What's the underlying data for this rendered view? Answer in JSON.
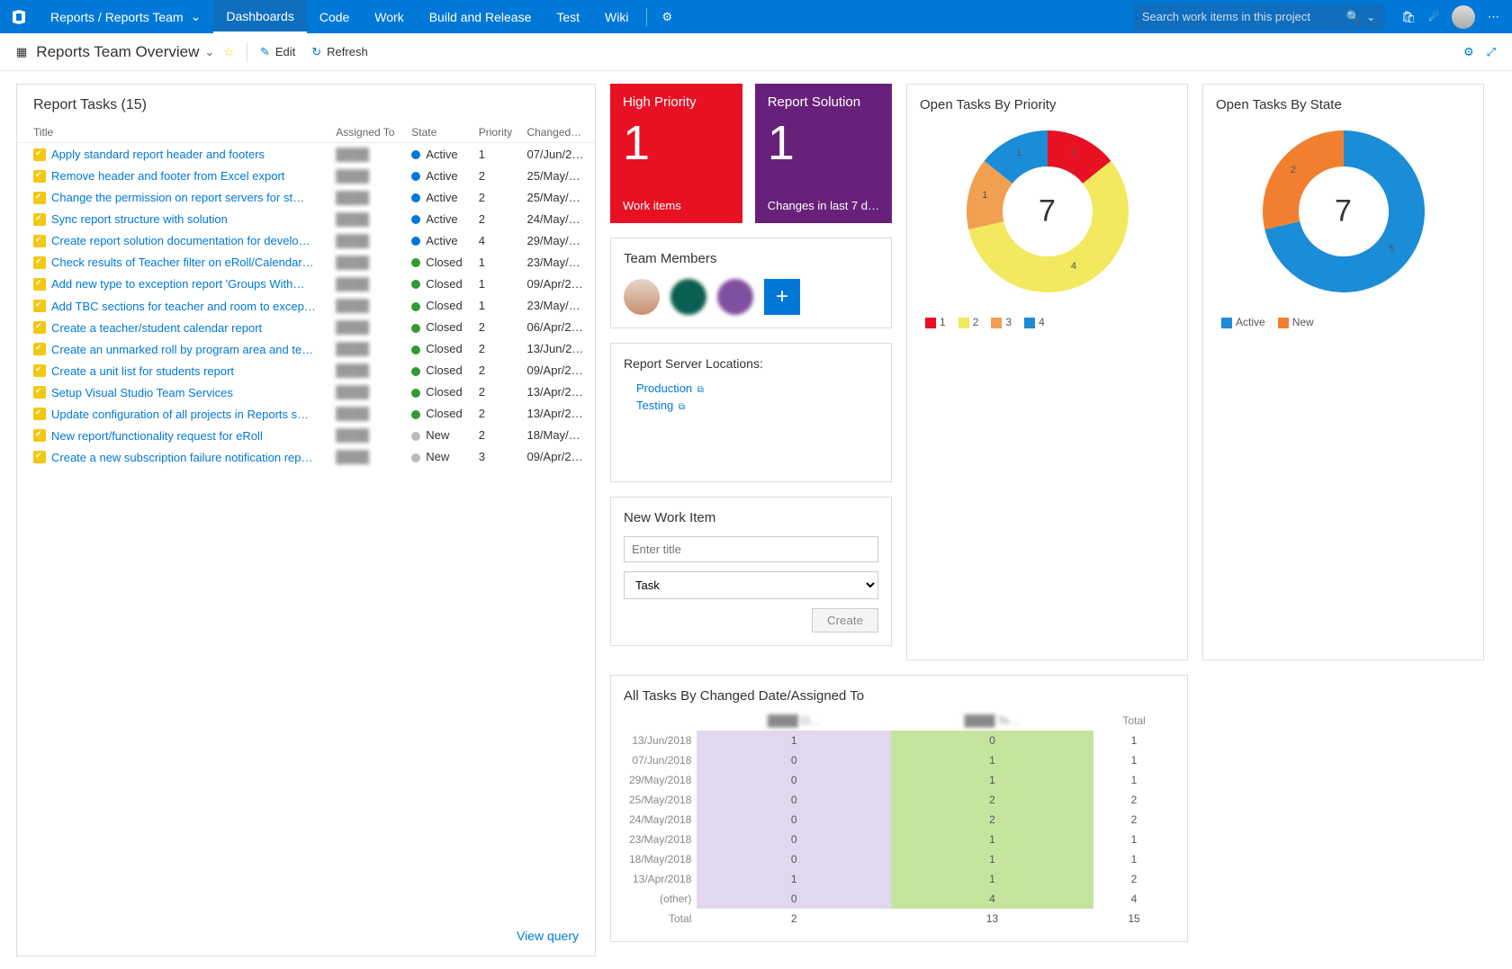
{
  "topbar": {
    "project": "Reports / Reports Team",
    "nav": [
      "Dashboards",
      "Code",
      "Work",
      "Build and Release",
      "Test",
      "Wiki"
    ],
    "active_nav": 0,
    "search_placeholder": "Search work items in this project"
  },
  "toolbar": {
    "title": "Reports Team Overview",
    "edit_label": "Edit",
    "refresh_label": "Refresh"
  },
  "tasks": {
    "title": "Report Tasks (15)",
    "columns": [
      "Title",
      "Assigned To",
      "State",
      "Priority",
      "Changed…"
    ],
    "view_query_label": "View query",
    "rows": [
      {
        "title": "Apply standard report header and footers",
        "assigned": "████",
        "state": "Active",
        "priority": "1",
        "changed": "07/Jun/2…"
      },
      {
        "title": "Remove header and footer from Excel export",
        "assigned": "████",
        "state": "Active",
        "priority": "2",
        "changed": "25/May/…"
      },
      {
        "title": "Change the permission on report servers for st…",
        "assigned": "████",
        "state": "Active",
        "priority": "2",
        "changed": "25/May/…"
      },
      {
        "title": "Sync report structure with solution",
        "assigned": "████",
        "state": "Active",
        "priority": "2",
        "changed": "24/May/…"
      },
      {
        "title": "Create report solution documentation for develo…",
        "assigned": "████",
        "state": "Active",
        "priority": "4",
        "changed": "29/May/…"
      },
      {
        "title": "Check results of Teacher filter on eRoll/Calendar…",
        "assigned": "████",
        "state": "Closed",
        "priority": "1",
        "changed": "23/May/…"
      },
      {
        "title": "Add new type to exception report 'Groups With…",
        "assigned": "████",
        "state": "Closed",
        "priority": "1",
        "changed": "09/Apr/2…"
      },
      {
        "title": "Add TBC sections for teacher and room to excep…",
        "assigned": "████",
        "state": "Closed",
        "priority": "1",
        "changed": "23/May/…"
      },
      {
        "title": "Create a teacher/student calendar report",
        "assigned": "████",
        "state": "Closed",
        "priority": "2",
        "changed": "06/Apr/2…"
      },
      {
        "title": "Create an unmarked roll by program area and te…",
        "assigned": "████",
        "state": "Closed",
        "priority": "2",
        "changed": "13/Jun/2…"
      },
      {
        "title": "Create a unit list for students report",
        "assigned": "████",
        "state": "Closed",
        "priority": "2",
        "changed": "09/Apr/2…"
      },
      {
        "title": "Setup Visual Studio Team Services",
        "assigned": "████",
        "state": "Closed",
        "priority": "2",
        "changed": "13/Apr/2…"
      },
      {
        "title": "Update configuration of all projects in Reports s…",
        "assigned": "████",
        "state": "Closed",
        "priority": "2",
        "changed": "13/Apr/2…"
      },
      {
        "title": "New report/functionality request for eRoll",
        "assigned": "████",
        "state": "New",
        "priority": "2",
        "changed": "18/May/…"
      },
      {
        "title": "Create a new subscription failure notification rep…",
        "assigned": "████",
        "state": "New",
        "priority": "3",
        "changed": "09/Apr/2…"
      }
    ]
  },
  "count_tiles": [
    {
      "title": "High Priority",
      "count": "1",
      "sub": "Work items",
      "color": "red"
    },
    {
      "title": "Report Solution",
      "count": "1",
      "sub": "Changes in last 7 d…",
      "color": "purple"
    }
  ],
  "team": {
    "title": "Team Members"
  },
  "locations": {
    "title": "Report Server Locations:",
    "links": [
      "Production",
      "Testing"
    ]
  },
  "new_item": {
    "title": "New Work Item",
    "placeholder": "Enter title",
    "type": "Task",
    "create_label": "Create"
  },
  "chart_data": [
    {
      "type": "donut",
      "title": "Open Tasks By Priority",
      "center": "7",
      "series": [
        {
          "name": "1",
          "value": 1,
          "color": "#e81123"
        },
        {
          "name": "2",
          "value": 4,
          "color": "#f2e95e"
        },
        {
          "name": "3",
          "value": 1,
          "color": "#f0a050"
        },
        {
          "name": "4",
          "value": 1,
          "color": "#1a8cd8"
        }
      ],
      "legend": [
        "1",
        "2",
        "3",
        "4"
      ]
    },
    {
      "type": "donut",
      "title": "Open Tasks By State",
      "center": "7",
      "series": [
        {
          "name": "Active",
          "value": 5,
          "color": "#1a8cd8"
        },
        {
          "name": "New",
          "value": 2,
          "color": "#f08030"
        }
      ],
      "legend": [
        "Active",
        "New"
      ]
    }
  ],
  "matrix": {
    "title": "All Tasks By Changed Date/Assigned To",
    "col_headers": [
      "",
      "████ O…",
      "████ Te…",
      "Total"
    ],
    "rows": [
      [
        "13/Jun/2018",
        "1",
        "0",
        "1"
      ],
      [
        "07/Jun/2018",
        "0",
        "1",
        "1"
      ],
      [
        "29/May/2018",
        "0",
        "1",
        "1"
      ],
      [
        "25/May/2018",
        "0",
        "2",
        "2"
      ],
      [
        "24/May/2018",
        "0",
        "2",
        "2"
      ],
      [
        "23/May/2018",
        "0",
        "1",
        "1"
      ],
      [
        "18/May/2018",
        "0",
        "1",
        "1"
      ],
      [
        "13/Apr/2018",
        "1",
        "1",
        "2"
      ],
      [
        "(other)",
        "0",
        "4",
        "4"
      ],
      [
        "Total",
        "2",
        "13",
        "15"
      ]
    ]
  }
}
